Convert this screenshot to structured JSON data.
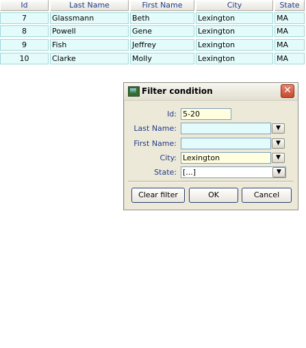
{
  "grid": {
    "columns": [
      "Id",
      "Last Name",
      "First Name",
      "City",
      "State"
    ],
    "rows": [
      {
        "id": "7",
        "last": "Glassmann",
        "first": "Beth",
        "city": "Lexington",
        "state": "MA"
      },
      {
        "id": "8",
        "last": "Powell",
        "first": "Gene",
        "city": "Lexington",
        "state": "MA"
      },
      {
        "id": "9",
        "last": "Fish",
        "first": "Jeffrey",
        "city": "Lexington",
        "state": "MA"
      },
      {
        "id": "10",
        "last": "Clarke",
        "first": "Molly",
        "city": "Lexington",
        "state": "MA"
      }
    ]
  },
  "dialog": {
    "title": "Filter condition",
    "close_glyph": "✕",
    "icons": {
      "app": "filter-dialog-icon",
      "close": "close-icon",
      "dropdown": "chevron-down-icon"
    },
    "fields": {
      "id": {
        "label": "Id:",
        "value": "5-20"
      },
      "last_name": {
        "label": "Last Name:",
        "value": ""
      },
      "first_name": {
        "label": "First Name:",
        "value": ""
      },
      "city": {
        "label": "City:",
        "value": "Lexington"
      },
      "state": {
        "label": "State:",
        "value": "[...]"
      }
    },
    "buttons": {
      "clear": "Clear filter",
      "ok": "OK",
      "cancel": "Cancel"
    },
    "colors": {
      "filled_field": "#ffffe0",
      "empty_field": "#e4fbfb",
      "label": "#1f3b8a"
    }
  }
}
